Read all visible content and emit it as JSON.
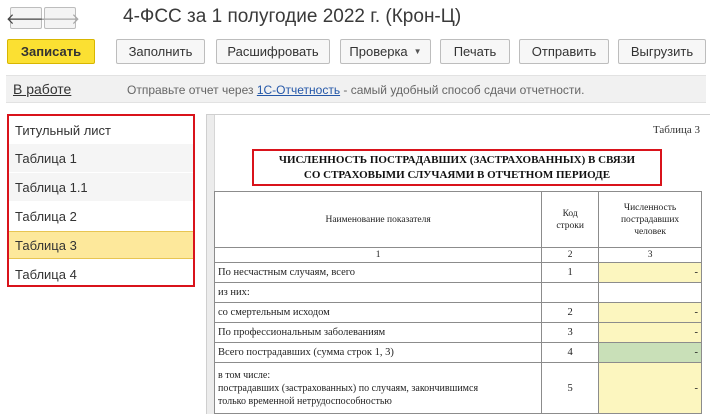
{
  "window": {
    "back_icon": "arrow-left-icon",
    "forward_icon": "arrow-right-icon",
    "back_glyph": "🡐",
    "forward_glyph": "🡒",
    "title": "4-ФСС за 1 полугодие 2022 г. (Крон-Ц)"
  },
  "toolbar": {
    "save": "Записать",
    "fill": "Заполнить",
    "decode": "Расшифровать",
    "check": "Проверка",
    "print": "Печать",
    "send": "Отправить",
    "export": "Выгрузить"
  },
  "infobar": {
    "status": "В работе",
    "text_before": "Отправьте отчет через ",
    "link": "1С-Отчетность",
    "text_after": " - самый удобный способ сдачи отчетности."
  },
  "nav": {
    "items": [
      "Титульный лист",
      "Таблица 1",
      "Таблица 1.1",
      "Таблица 2",
      "Таблица 3",
      "Таблица 4"
    ],
    "active": "Таблица 3"
  },
  "document": {
    "table_label": "Таблица 3",
    "heading_line1": "ЧИСЛЕННОСТЬ ПОСТРАДАВШИХ (ЗАСТРАХОВАННЫХ) В СВЯЗИ",
    "heading_line2": "СО СТРАХОВЫМИ СЛУЧАЯМИ В ОТЧЕТНОМ ПЕРИОДЕ",
    "columns": {
      "name": "Наименование показателя",
      "code_l1": "Код",
      "code_l2": "строки",
      "value_l1": "Численность",
      "value_l2": "пострадавших",
      "value_l3": "человек"
    },
    "column_numbers": [
      "1",
      "2",
      "3"
    ],
    "rows": [
      {
        "name": "По несчастным случаям, всего",
        "code": "1",
        "value": "-"
      },
      {
        "name": "из них:",
        "code": "",
        "value": ""
      },
      {
        "name": "со смертельным исходом",
        "code": "2",
        "value": "-"
      },
      {
        "name": "По профессиональным заболеваниям",
        "code": "3",
        "value": "-"
      },
      {
        "name": "Всего пострадавших (сумма строк 1, 3)",
        "code": "4",
        "value": "-"
      },
      {
        "name_l1": "в том числе:",
        "name_l2": "пострадавших (застрахованных) по случаям, закончившимся",
        "name_l3": "только  временной  нетрудоспособностью",
        "code": "5",
        "value": "-"
      }
    ]
  }
}
